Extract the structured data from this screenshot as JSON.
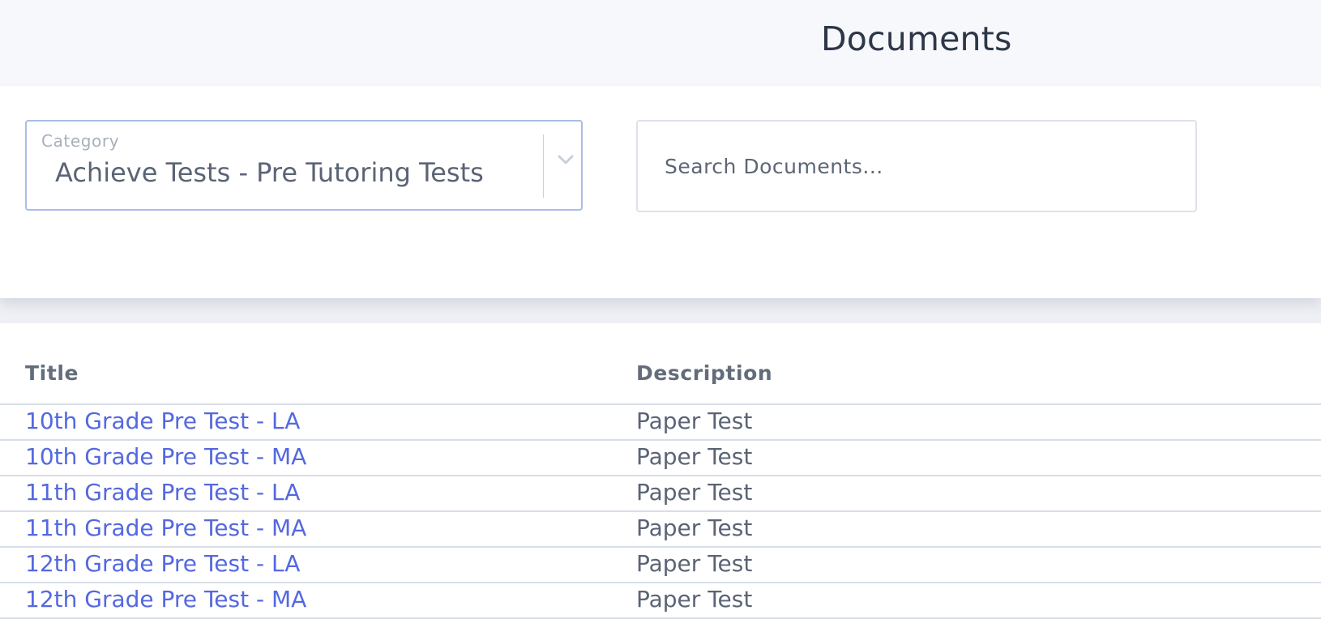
{
  "header": {
    "title": "Documents"
  },
  "filters": {
    "category_label": "Category",
    "category_value": "Achieve Tests - Pre Tutoring Tests",
    "search_placeholder": "Search Documents..."
  },
  "table": {
    "columns": [
      "Title",
      "Description"
    ],
    "rows": [
      {
        "title": "10th Grade Pre Test - LA",
        "description": "Paper Test"
      },
      {
        "title": "10th Grade Pre Test - MA",
        "description": "Paper Test"
      },
      {
        "title": "11th Grade Pre Test - LA",
        "description": "Paper Test"
      },
      {
        "title": "11th Grade Pre Test - MA",
        "description": "Paper Test"
      },
      {
        "title": "12th Grade Pre Test - LA",
        "description": "Paper Test"
      },
      {
        "title": "12th Grade Pre Test - MA",
        "description": "Paper Test"
      }
    ]
  },
  "colors": {
    "link": "#5468e0",
    "header_bg": "#f7f8fc",
    "select_border": "#a9bde6",
    "text": "#2d3748"
  },
  "icons": {
    "select_toggle": "chevron-down-icon"
  }
}
